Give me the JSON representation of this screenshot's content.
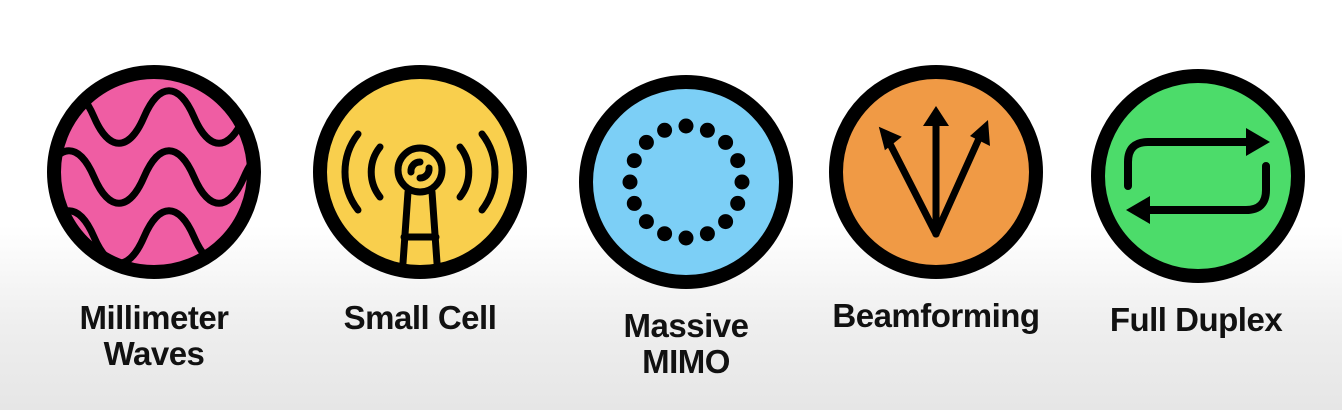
{
  "colors": {
    "outline": "#000000",
    "pink": "#ef5da3",
    "yellow": "#f9cf4d",
    "blue": "#7ccff6",
    "orange": "#f09a45",
    "green": "#4cdc6a"
  },
  "items": [
    {
      "label": "Millimeter\nWaves",
      "icon": "sine-waves-icon",
      "color": "#ef5da3"
    },
    {
      "label": "Small Cell",
      "icon": "cell-tower-icon",
      "color": "#f9cf4d"
    },
    {
      "label": "Massive\nMIMO",
      "icon": "antenna-array-icon",
      "color": "#7ccff6"
    },
    {
      "label": "Beamforming",
      "icon": "beam-arrows-icon",
      "color": "#f09a45"
    },
    {
      "label": "Full Duplex",
      "icon": "two-way-arrows-icon",
      "color": "#4cdc6a"
    }
  ]
}
